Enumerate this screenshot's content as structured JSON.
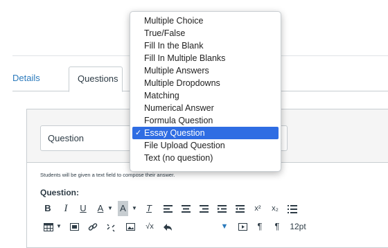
{
  "tabs": {
    "details": "Details",
    "questions": "Questions"
  },
  "question_type": {
    "current": "Question",
    "options": [
      {
        "label": "Multiple Choice",
        "selected": false
      },
      {
        "label": "True/False",
        "selected": false
      },
      {
        "label": "Fill In the Blank",
        "selected": false
      },
      {
        "label": "Fill In Multiple Blanks",
        "selected": false
      },
      {
        "label": "Multiple Answers",
        "selected": false
      },
      {
        "label": "Multiple Dropdowns",
        "selected": false
      },
      {
        "label": "Matching",
        "selected": false
      },
      {
        "label": "Numerical Answer",
        "selected": false
      },
      {
        "label": "Formula Question",
        "selected": false
      },
      {
        "label": "Essay Question",
        "selected": true
      },
      {
        "label": "File Upload Question",
        "selected": false
      },
      {
        "label": "Text (no question)",
        "selected": false
      }
    ],
    "check_glyph": "✓"
  },
  "hint": "Students will be given a text field to compose their answer.",
  "question_label": "Question:",
  "toolbar": {
    "bold": "B",
    "italic": "I",
    "underline": "U",
    "font_color": "A",
    "background_color": "A",
    "clear_format": "T",
    "superscript": "x²",
    "subscript": "x₂",
    "font_size": "12pt"
  },
  "colors": {
    "accent": "#2b7abc",
    "menu_selected": "#2f6de3",
    "border": "#c7cdd1"
  }
}
